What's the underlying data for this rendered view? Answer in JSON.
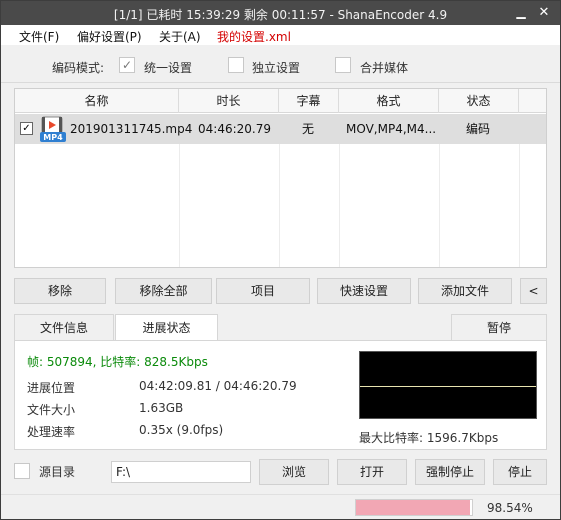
{
  "window": {
    "title": "[1/1] 已耗时 15:39:29  剩余 00:11:57 - ShanaEncoder 4.9",
    "minimize": "▁",
    "close": "✕"
  },
  "menu": {
    "file": "文件(F)",
    "prefs": "偏好设置(P)",
    "about": "关于(A)",
    "my_settings": "我的设置.xml"
  },
  "mode": {
    "label": "编码模式:",
    "unified": "统一设置",
    "independent": "独立设置",
    "merge": "合并媒体",
    "unified_checked": true
  },
  "table": {
    "headers": [
      "名称",
      "时长",
      "字幕",
      "格式",
      "状态"
    ],
    "rows": [
      {
        "checked": true,
        "icon_label": "MP4",
        "name": "201901311745.mp4",
        "duration": "04:46:20.79",
        "subtitle": "无",
        "format": "MOV,MP4,M4...",
        "status": "编码"
      }
    ]
  },
  "actions": {
    "remove": "移除",
    "remove_all": "移除全部",
    "item": "项目",
    "quick_settings": "快速设置",
    "add_file": "添加文件",
    "collapse": "<"
  },
  "tabs": {
    "file_info": "文件信息",
    "progress": "进展状态",
    "pause": "暂停"
  },
  "progress_panel": {
    "stat_line": "帧: 507894, 比特率: 828.5Kbps",
    "position_label": "进展位置",
    "position_value": "04:42:09.81 / 04:46:20.79",
    "size_label": "文件大小",
    "size_value": "1.63GB",
    "speed_label": "处理速率",
    "speed_value": "0.35x (9.0fps)",
    "max_bitrate": "最大比特率: 1596.7Kbps"
  },
  "bottom": {
    "source_dir_label": "源目录",
    "path_value": "F:\\",
    "browse": "浏览",
    "open": "打开",
    "force_stop": "强制停止",
    "stop": "停止"
  },
  "status": {
    "progress_percent": "98.54%",
    "progress_fraction": 0.9854,
    "progress_color": "#f2a7b4"
  }
}
